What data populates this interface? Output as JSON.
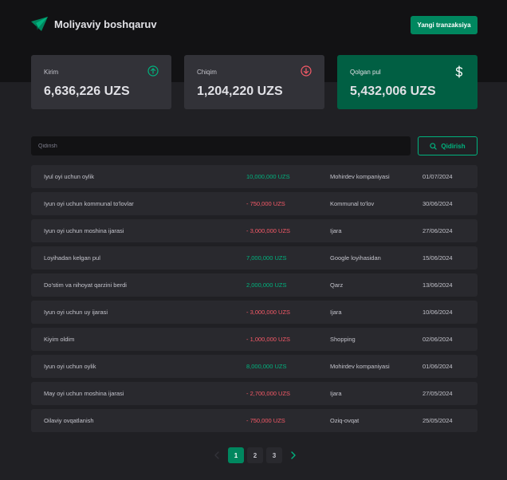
{
  "app": {
    "title": "Moliyaviy boshqaruv",
    "new_transaction_label": "Yangi tranzaksiya"
  },
  "summary": {
    "income": {
      "label": "Kirim",
      "value": "6,636,226 UZS",
      "icon": "arrow-up-circle-icon"
    },
    "expense": {
      "label": "Chiqim",
      "value": "1,204,220 UZS",
      "icon": "arrow-down-circle-icon"
    },
    "balance": {
      "label": "Qolgan pul",
      "value": "5,432,006 UZS",
      "icon": "dollar-icon"
    }
  },
  "search": {
    "placeholder": "Qidirish",
    "button_label": "Qidirish"
  },
  "transactions": [
    {
      "description": "Iyul oyi uchun oylik",
      "amount": "10,000,000 UZS",
      "type": "income",
      "category": "Mohirdev kompaniyasi",
      "date": "01/07/2024"
    },
    {
      "description": "Iyun oyi uchun kommunal to'lovlar",
      "amount": "- 750,000 UZS",
      "type": "outcome",
      "category": "Kommunal to'lov",
      "date": "30/06/2024"
    },
    {
      "description": "Iyun oyi uchun moshina ijarasi",
      "amount": "- 3,000,000 UZS",
      "type": "outcome",
      "category": "Ijara",
      "date": "27/06/2024"
    },
    {
      "description": "Loyihadan kelgan pul",
      "amount": "7,000,000 UZS",
      "type": "income",
      "category": "Google loyihasidan",
      "date": "15/06/2024"
    },
    {
      "description": "Do'stim va nihoyat qarzini berdi",
      "amount": "2,000,000 UZS",
      "type": "income",
      "category": "Qarz",
      "date": "13/06/2024"
    },
    {
      "description": "Iyun oyi uchun uy ijarasi",
      "amount": "- 3,000,000 UZS",
      "type": "outcome",
      "category": "Ijara",
      "date": "10/06/2024"
    },
    {
      "description": "Kiyim oldim",
      "amount": "- 1,000,000 UZS",
      "type": "outcome",
      "category": "Shopping",
      "date": "02/06/2024"
    },
    {
      "description": "Iyun oyi uchun oylik",
      "amount": "8,000,000 UZS",
      "type": "income",
      "category": "Mohirdev kompaniyasi",
      "date": "01/06/2024"
    },
    {
      "description": "May oyi uchun moshina ijarasi",
      "amount": "- 2,700,000 UZS",
      "type": "outcome",
      "category": "Ijara",
      "date": "27/05/2024"
    },
    {
      "description": "Oilaviy ovqatlanish",
      "amount": "- 750,000 UZS",
      "type": "outcome",
      "category": "Oziq-ovqat",
      "date": "25/05/2024"
    }
  ],
  "pagination": {
    "pages": [
      "1",
      "2",
      "3"
    ],
    "active": "1"
  },
  "colors": {
    "accent": "#00875f",
    "income": "#00b37e",
    "outcome": "#f75a68"
  }
}
